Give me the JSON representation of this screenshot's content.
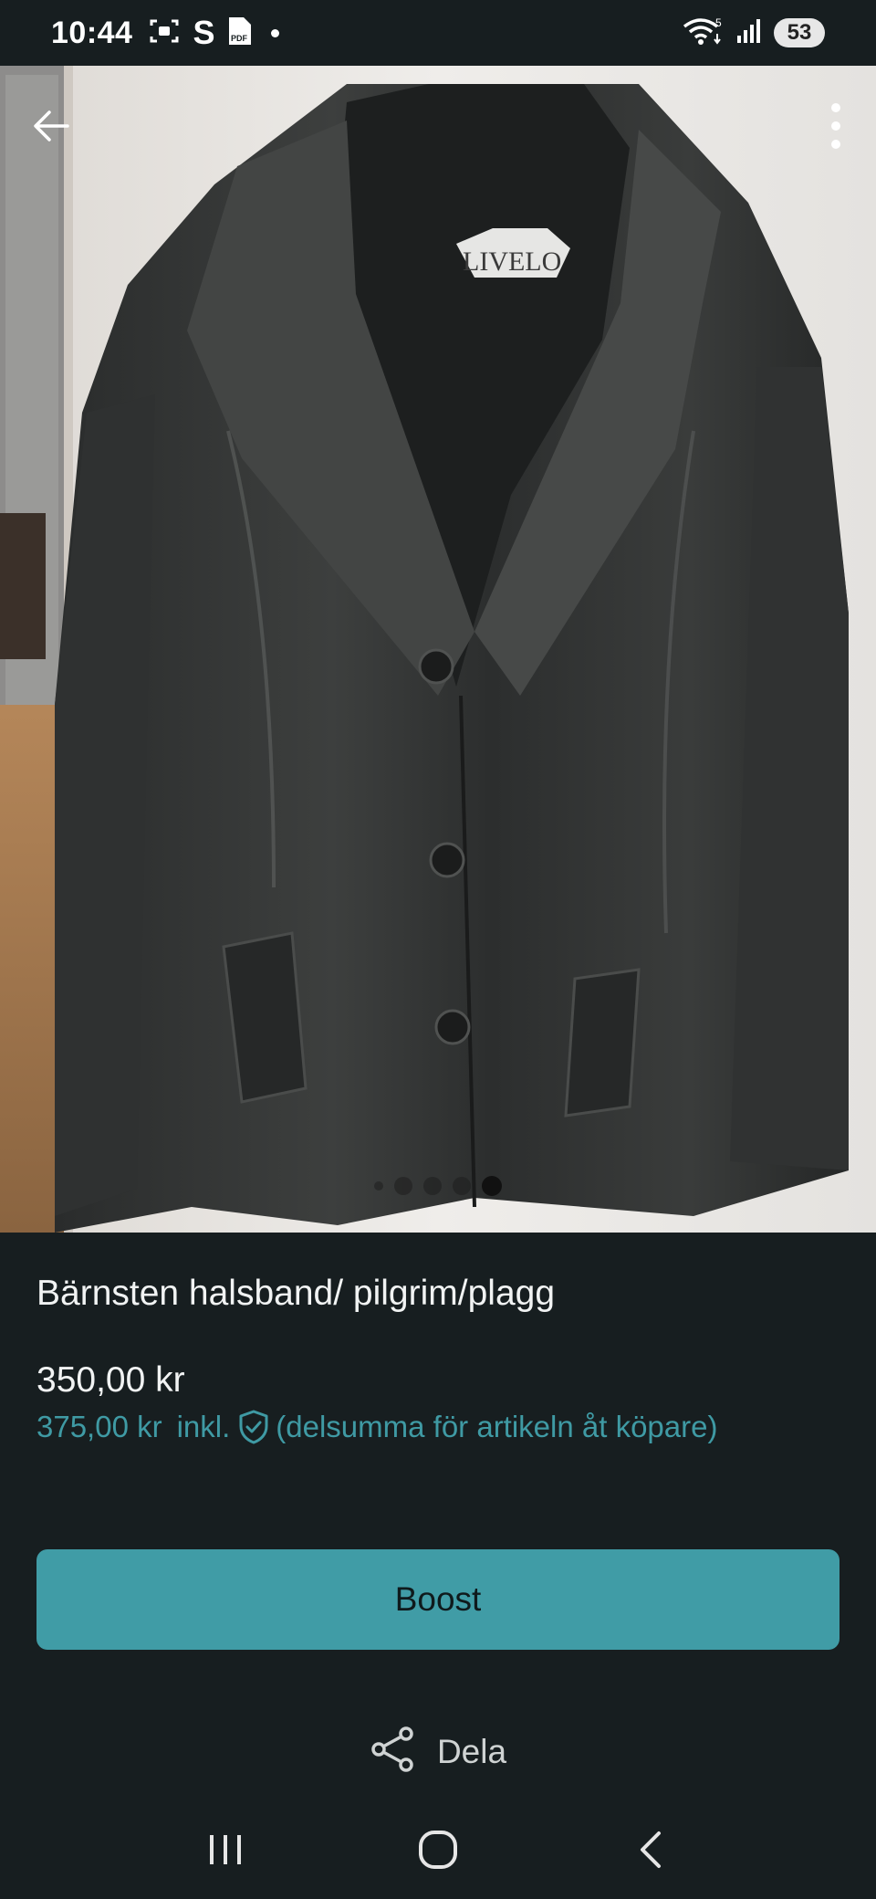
{
  "status_bar": {
    "time": "10:44",
    "s_label": "S",
    "pdf_label": "PDF",
    "wifi_badge": "5",
    "battery": "53"
  },
  "photo": {
    "brand_label": "LIVELO",
    "page_indicator": {
      "count": 5,
      "active_index": 4
    }
  },
  "item": {
    "title": "Bärnsten halsband/ pilgrim/plagg",
    "price": "350,00 kr",
    "price_incl_amount": "375,00 kr",
    "price_incl_word": "inkl.",
    "price_incl_note": "(delsumma för artikeln åt köpare)"
  },
  "actions": {
    "boost_label": "Boost",
    "share_label": "Dela"
  },
  "colors": {
    "background": "#171e20",
    "accent": "#409ca6",
    "accent_text": "#3f9aa4"
  },
  "icons": [
    "screenshot-icon",
    "pdf-icon",
    "wifi-icon",
    "signal-icon",
    "back-arrow-icon",
    "more-vertical-icon",
    "shield-check-icon",
    "share-icon",
    "recents-icon",
    "home-icon",
    "nav-back-icon"
  ]
}
